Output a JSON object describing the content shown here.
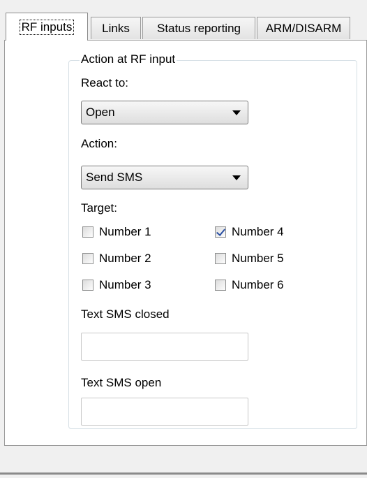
{
  "tabs": [
    {
      "label": "RF inputs",
      "active": true
    },
    {
      "label": "Links",
      "active": false
    },
    {
      "label": "Status reporting",
      "active": false
    },
    {
      "label": "ARM/DISARM",
      "active": false
    }
  ],
  "group": {
    "title": "Action at RF input",
    "react_to": {
      "label": "React to:",
      "value": "Open"
    },
    "action": {
      "label": "Action:",
      "value": "Send SMS"
    },
    "target": {
      "label": "Target:",
      "numbers": [
        {
          "label": "Number 1",
          "checked": false
        },
        {
          "label": "Number 2",
          "checked": false
        },
        {
          "label": "Number 3",
          "checked": false
        },
        {
          "label": "Number 4",
          "checked": true
        },
        {
          "label": "Number 5",
          "checked": false
        },
        {
          "label": "Number 6",
          "checked": false
        }
      ]
    },
    "sms_closed": {
      "label": "Text SMS closed",
      "value": ""
    },
    "sms_open": {
      "label": "Text SMS open",
      "value": ""
    }
  },
  "icons": {
    "dropdown": "chevron-down-icon",
    "check": "checkmark-icon"
  }
}
